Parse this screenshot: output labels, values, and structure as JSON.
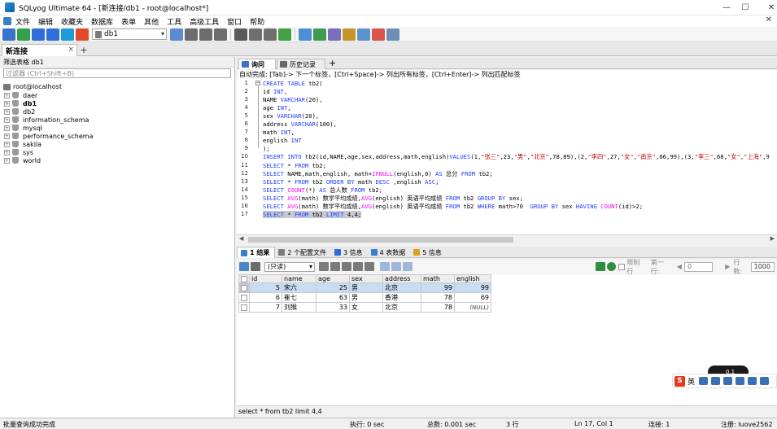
{
  "window": {
    "title": "SQLyog Ultimate 64 - [新连接/db1 - root@localhost*]",
    "min": "—",
    "max": "☐",
    "close": "✕",
    "mdi_close": "✕"
  },
  "menu": [
    "文件",
    "编辑",
    "收藏夹",
    "数据库",
    "表单",
    "其他",
    "工具",
    "高级工具",
    "窗口",
    "帮助"
  ],
  "toolbar": {
    "database_selector": "db1",
    "colors": [
      "#3a74c9",
      "#33a04a",
      "#2f6ed8",
      "#2f6ed8",
      "#1d9bd6",
      "#e04a2a",
      "#5a8ad0",
      "#6c6c6c",
      "#6c6c6c",
      "#6c6c6c",
      "#5a5a5a",
      "#6f6f6f",
      "#6f6f6f",
      "#43a047",
      "#4c8fd6",
      "#3f9b4f",
      "#7a6fb8",
      "#c6952a",
      "#5d93cc",
      "#d9544d",
      "#6c8fb5"
    ]
  },
  "connection_tab": {
    "label": "新连接",
    "close": "×",
    "add": "+"
  },
  "object_browser": {
    "filter_label": "筛选表格 db1",
    "filter_placeholder": "过滤器 (Ctrl+Shift+B)",
    "root": "root@localhost",
    "databases": [
      {
        "name": "daer",
        "bold": false
      },
      {
        "name": "db1",
        "bold": true
      },
      {
        "name": "db2",
        "bold": false
      },
      {
        "name": "information_schema",
        "bold": false
      },
      {
        "name": "mysql",
        "bold": false
      },
      {
        "name": "performance_schema",
        "bold": false
      },
      {
        "name": "sakila",
        "bold": false
      },
      {
        "name": "sys",
        "bold": false
      },
      {
        "name": "world",
        "bold": false
      }
    ]
  },
  "query_tabs": {
    "query": "询问",
    "history": "历史记录",
    "add": "+"
  },
  "autocomplete_hint": "自动完成: [Tab]-> 下一个标签，[Ctrl+Space]-> 列出所有标签，[Ctrl+Enter]-> 列出匹配标签",
  "editor": {
    "line_numbers": [
      "1",
      "2",
      "3",
      "4",
      "5",
      "6",
      "7",
      "8",
      "9",
      "10",
      "11",
      "12",
      "13",
      "14",
      "15",
      "16",
      "17"
    ],
    "lines": [
      "CREATE TABLE tb2(",
      "id INT,",
      "NAME VARCHAR(20),",
      "age INT,",
      "sex VARCHAR(20),",
      "address VARCHAR(100),",
      "math INT,",
      "english INT",
      ");",
      "INSERT INTO tb2(id,NAME,age,sex,address,math,english)VALUES(1,\"张三\",23,\"男\",\"北京\",78,89),(2,\"李四\",27,\"女\",\"南京\",66,99),(3,\"李三\",68,\"女\",\"上海\",9",
      "SELECT * FROM tb2;",
      "SELECT NAME,math,english, math+IFNULL(english,0) AS 总分 FROM tb2;",
      "SELECT * FROM tb2 ORDER BY math DESC ,english ASC;",
      "SELECT COUNT(*) AS 总人数 FROM tb2;",
      "SELECT AVG(math) 数学平均成绩,AVG(english) 英语平均成绩 FROM tb2 GROUP BY sex;",
      "SELECT AVG(math) 数学平均成绩,AVG(english) 英语平均成绩 FROM tb2 WHERE math>70  GROUP BY sex HAVING COUNT(id)>2;",
      "SELECT * FROM tb2 LIMIT 4,4;"
    ]
  },
  "result_tabs": [
    {
      "label": "1 结果",
      "color": "#3b7bd0"
    },
    {
      "label": "2 个配置文件",
      "color": "#7a7a7a"
    },
    {
      "label": "3 信息",
      "color": "#2f6ed8"
    },
    {
      "label": "4 表数据",
      "color": "#3b7bd0"
    },
    {
      "label": "5 信息",
      "color": "#d8a020"
    }
  ],
  "result_toolbar": {
    "mode": "(只读)",
    "limit_label": "限制行",
    "first_row_label": "第一行:",
    "first_row": "0",
    "rows_label": "行数:",
    "rows": "1000"
  },
  "result_grid": {
    "columns": [
      "id",
      "name",
      "age",
      "sex",
      "address",
      "math",
      "english"
    ],
    "rows": [
      {
        "id": "5",
        "name": "宋六",
        "age": "25",
        "sex": "男",
        "address": "北京",
        "math": "99",
        "english": "99",
        "selected": true
      },
      {
        "id": "6",
        "name": "崔七",
        "age": "63",
        "sex": "男",
        "address": "香港",
        "math": "78",
        "english": "69",
        "selected": false
      },
      {
        "id": "7",
        "name": "刘猴",
        "age": "33",
        "sex": "女",
        "address": "北京",
        "math": "78",
        "english": "(NULL)",
        "selected": false
      }
    ]
  },
  "sql_status": "select * from tb2 limit 4,4",
  "statusbar": {
    "message": "批量查询成功完成",
    "exec": "执行: 0 sec",
    "total": "总数: 0.001 sec",
    "rows": "3 行",
    "position": "Ln 17, Col 1",
    "connections": "连接: 1",
    "registered": "注册: luove2562"
  },
  "ime": {
    "logo": "S",
    "lang": "英",
    "badge": "0.1"
  }
}
